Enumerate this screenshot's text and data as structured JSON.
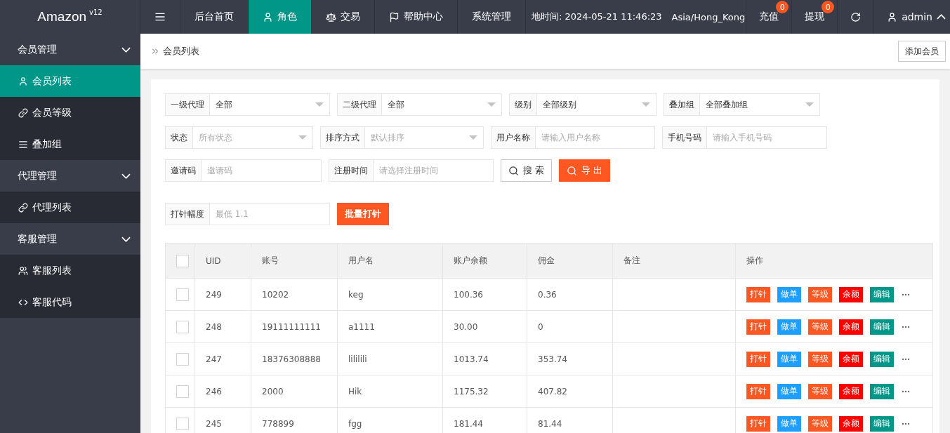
{
  "brand": {
    "name": "Amazon",
    "version": "v12"
  },
  "nav": [
    {
      "label": "后台首页",
      "selected": false
    },
    {
      "label": "角色",
      "selected": true
    },
    {
      "label": "交易",
      "selected": false
    },
    {
      "label": "帮助中心",
      "selected": false
    },
    {
      "label": "系统管理",
      "selected": false
    }
  ],
  "server_time": "地时间: 2024-05-21 11:46:23",
  "timezone": "Asia/Hong_Kong",
  "top_actions": [
    {
      "label": "充值",
      "badge": "0"
    },
    {
      "label": "提现",
      "badge": "0"
    }
  ],
  "user": {
    "name": "admin",
    "expanded": true
  },
  "sidebar": [
    {
      "label": "会员管理",
      "expanded": true,
      "children": [
        {
          "label": "会员列表",
          "selected": true
        },
        {
          "label": "会员等级",
          "selected": false
        },
        {
          "label": "叠加组",
          "selected": false
        }
      ]
    },
    {
      "label": "代理管理",
      "expanded": true,
      "children": [
        {
          "label": "代理列表",
          "selected": false
        }
      ]
    },
    {
      "label": "客服管理",
      "expanded": true,
      "children": [
        {
          "label": "客服列表",
          "selected": false
        },
        {
          "label": "客服代码",
          "selected": false
        }
      ]
    }
  ],
  "breadcrumb": "会员列表",
  "add_button": "添加会员",
  "filters": [
    {
      "kind": "select",
      "label": "一级代理",
      "value": "全部"
    },
    {
      "kind": "select",
      "label": "二级代理",
      "value": "全部"
    },
    {
      "kind": "select",
      "label": "级别",
      "value": "全部级别"
    },
    {
      "kind": "select",
      "label": "叠加组",
      "value": "全部叠加组"
    },
    {
      "kind": "select",
      "label": "状态",
      "placeholder": "所有状态"
    },
    {
      "kind": "select",
      "label": "排序方式",
      "placeholder": "默认排序"
    },
    {
      "kind": "input",
      "label": "用户名称",
      "placeholder": "请输入用户名称"
    },
    {
      "kind": "input",
      "label": "手机号码",
      "placeholder": "请输入手机号码"
    },
    {
      "kind": "input",
      "label": "邀请码",
      "placeholder": "邀请码"
    },
    {
      "kind": "input",
      "label": "注册时间",
      "placeholder": "请选择注册时间"
    },
    {
      "kind": "button",
      "label": "搜 索"
    },
    {
      "kind": "button",
      "label": "导 出"
    },
    {
      "kind": "input",
      "label": "打针幅度",
      "placeholder": "最低 1.1"
    },
    {
      "kind": "button",
      "label": "批量打针"
    }
  ],
  "table": {
    "columns": [
      "UID",
      "账号",
      "用户名",
      "账户余额",
      "佣金",
      "备注",
      "操作"
    ],
    "header_checked": false,
    "rows": [
      {
        "checked": false,
        "cells": [
          "249",
          "10202",
          "keg",
          "100.36",
          "0.36",
          ""
        ],
        "actions": [
          {
            "label": "打针",
            "color": "#ff5722"
          },
          {
            "label": "做单",
            "color": "#1e9fff"
          },
          {
            "label": "等级",
            "color": "#ff5722"
          },
          {
            "label": "余额",
            "color": "#ff0000"
          },
          {
            "label": "编辑",
            "color": "#009688"
          }
        ]
      },
      {
        "checked": false,
        "cells": [
          "248",
          "19111111111",
          "a1111",
          "30.00",
          "0",
          ""
        ],
        "actions": [
          {
            "label": "打针",
            "color": "#ff5722"
          },
          {
            "label": "做单",
            "color": "#1e9fff"
          },
          {
            "label": "等级",
            "color": "#ff5722"
          },
          {
            "label": "余额",
            "color": "#ff0000"
          },
          {
            "label": "编辑",
            "color": "#009688"
          }
        ]
      },
      {
        "checked": false,
        "cells": [
          "247",
          "18376308888",
          "lililili",
          "1013.74",
          "353.74",
          ""
        ],
        "actions": [
          {
            "label": "打针",
            "color": "#ff5722"
          },
          {
            "label": "做单",
            "color": "#1e9fff"
          },
          {
            "label": "等级",
            "color": "#ff5722"
          },
          {
            "label": "余额",
            "color": "#ff0000"
          },
          {
            "label": "编辑",
            "color": "#009688"
          }
        ]
      },
      {
        "checked": false,
        "cells": [
          "246",
          "2000",
          "Hik",
          "1175.32",
          "407.82",
          ""
        ],
        "actions": [
          {
            "label": "打针",
            "color": "#ff5722"
          },
          {
            "label": "做单",
            "color": "#1e9fff"
          },
          {
            "label": "等级",
            "color": "#ff5722"
          },
          {
            "label": "余额",
            "color": "#ff0000"
          },
          {
            "label": "编辑",
            "color": "#009688"
          }
        ]
      },
      {
        "checked": false,
        "cells": [
          "245",
          "778899",
          "fgg",
          "181.44",
          "81.44",
          ""
        ],
        "actions": [
          {
            "label": "打针",
            "color": "#ff5722"
          },
          {
            "label": "做单",
            "color": "#1e9fff"
          },
          {
            "label": "等级",
            "color": "#ff5722"
          },
          {
            "label": "余额",
            "color": "#ff0000"
          },
          {
            "label": "编辑",
            "color": "#009688"
          }
        ]
      }
    ]
  }
}
